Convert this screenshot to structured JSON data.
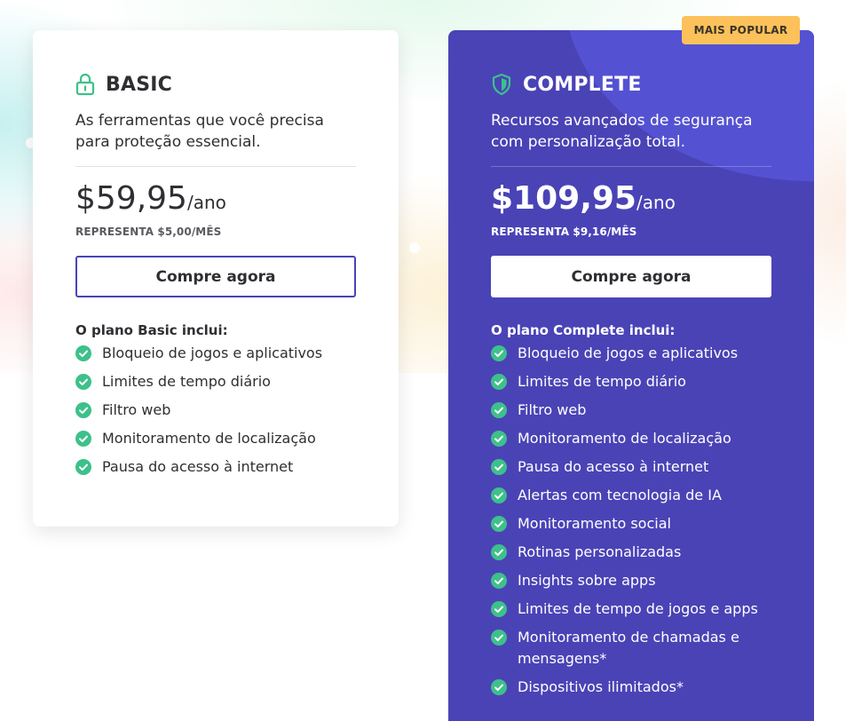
{
  "accent_colors": {
    "brand": "#4a43b6",
    "check": "#3ec08b",
    "badge": "#fcc15a"
  },
  "basic": {
    "icon": "lock-icon",
    "title": "BASIC",
    "description": "As ferramentas que você precisa para proteção essencial.",
    "price": "$59,95",
    "period": "/ano",
    "represents": "REPRESENTA $5,00/MÊS",
    "buy_label": "Compre agora",
    "includes_label": "O plano Basic inclui:",
    "features": [
      "Bloqueio de jogos e aplicativos",
      "Limites de tempo diário",
      "Filtro web",
      "Monitoramento de localização",
      "Pausa do acesso à internet"
    ]
  },
  "complete": {
    "icon": "shield-icon",
    "badge": "MAIS POPULAR",
    "title": "COMPLETE",
    "description": "Recursos avançados de segurança com personalização total.",
    "price": "$109,95",
    "period": "/ano",
    "represents": "REPRESENTA $9,16/MÊS",
    "buy_label": "Compre agora",
    "includes_label": "O plano Complete inclui:",
    "features": [
      "Bloqueio de jogos e aplicativos",
      "Limites de tempo diário",
      "Filtro web",
      "Monitoramento de localização",
      "Pausa do acesso à internet",
      "Alertas com tecnologia de IA",
      "Monitoramento social",
      "Rotinas personalizadas",
      "Insights sobre apps",
      "Limites de tempo de jogos e apps",
      "Monitoramento de chamadas e mensagens*",
      "Dispositivos ilimitados*"
    ]
  }
}
